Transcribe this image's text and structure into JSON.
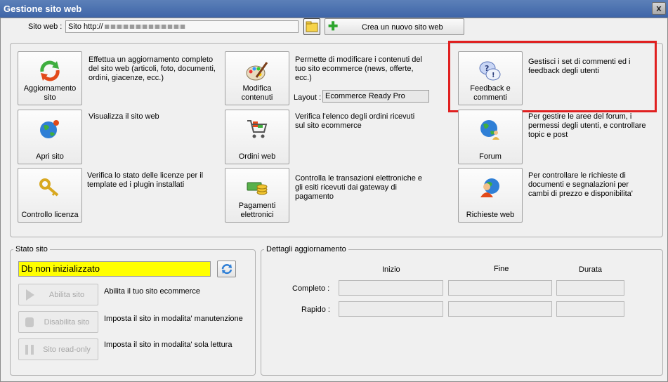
{
  "window": {
    "title": "Gestione sito web",
    "close_label": "x"
  },
  "site": {
    "label": "Sito web :",
    "value": "Sito http://",
    "new_site_label": "Crea un nuovo sito web"
  },
  "actions": {
    "aggiornamento": {
      "label1": "Aggiornamento",
      "label2": "sito",
      "desc": "Effettua un aggiornamento completo del sito web (articoli, foto, documenti, ordini, giacenze, ecc.)"
    },
    "modifica": {
      "label1": "Modifica",
      "label2": "contenuti",
      "desc": "Permette di modificare i contenuti del tuo sito ecommerce (news, offerte, ecc.)"
    },
    "feedback": {
      "label1": "Feedback e",
      "label2": "commenti",
      "desc": "Gestisci i set di commenti ed i feedback degli utenti"
    },
    "apri": {
      "label": "Apri sito",
      "desc": "Visualizza il sito web"
    },
    "ordini": {
      "label": "Ordini web",
      "desc": "Verifica l'elenco degli ordini ricevuti sul sito ecommerce"
    },
    "forum": {
      "label": "Forum",
      "desc": "Per gestire le aree del forum, i permessi degli utenti, e controllare topic e post"
    },
    "licenza": {
      "label": "Controllo licenza",
      "desc": "Verifica lo stato delle licenze per il template ed i plugin installati"
    },
    "pagamenti": {
      "label1": "Pagamenti",
      "label2": "elettronici",
      "desc": "Controlla le transazioni elettroniche e gli esiti ricevuti dai gateway di pagamento"
    },
    "richieste": {
      "label": "Richieste web",
      "desc": "Per controllare le richieste di documenti e segnalazioni per cambi di prezzo e disponibilita'"
    }
  },
  "layout_field": {
    "label": "Layout :",
    "value": "Ecommerce Ready Pro"
  },
  "stato": {
    "legend": "Stato sito",
    "status": "Db non inizializzato",
    "status_color": "#ffff00",
    "abilita": {
      "label": "Abilita sito",
      "desc": "Abilita il tuo sito ecommerce"
    },
    "disabilita": {
      "label": "Disabilita sito",
      "desc": "Imposta il sito in modalita' manutenzione"
    },
    "readonly": {
      "label": "Sito read-only",
      "desc": "Imposta il sito in modalita' sola lettura"
    }
  },
  "dettagli": {
    "legend": "Dettagli aggiornamento",
    "col_inizio": "Inizio",
    "col_fine": "Fine",
    "col_durata": "Durata",
    "row_completo": "Completo :",
    "row_rapido": "Rapido :"
  },
  "highlight_color": "#e02020"
}
